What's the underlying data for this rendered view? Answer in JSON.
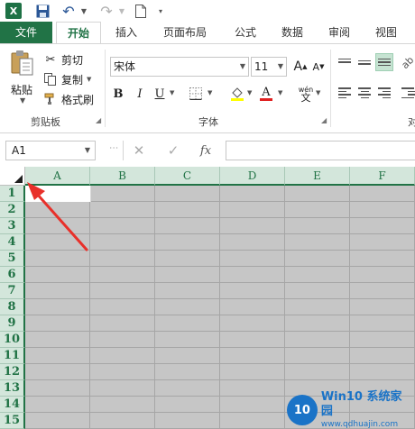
{
  "titlebar": {
    "app_icon_letter": "X"
  },
  "tabs": {
    "file": "文件",
    "home": "开始",
    "insert": "插入",
    "page_layout": "页面布局",
    "formulas": "公式",
    "data": "数据",
    "review": "审阅",
    "view": "视图"
  },
  "ribbon": {
    "paste": "粘贴",
    "cut": "剪切",
    "copy": "复制",
    "format_painter": "格式刷",
    "clipboard_label": "剪贴板",
    "font_name": "宋体",
    "font_size": "11",
    "grow_font": "A",
    "shrink_font": "A",
    "bold": "B",
    "italic": "I",
    "underline": "U",
    "font_color": "A",
    "phonetic": "wén",
    "font_label": "字体",
    "alignment_label_partial": "对"
  },
  "formula_bar": {
    "name_box": "A1",
    "fx": "fx",
    "cancel": "✕",
    "enter": "✓"
  },
  "grid": {
    "columns": [
      "A",
      "B",
      "C",
      "D",
      "E",
      "F"
    ],
    "rows": [
      "1",
      "2",
      "3",
      "4",
      "5",
      "6",
      "7",
      "8",
      "9",
      "10",
      "11",
      "12",
      "13",
      "14",
      "15"
    ]
  },
  "watermark": {
    "logo": "10",
    "title": "Win10 系统家园",
    "url": "www.qdhuajin.com"
  },
  "colors": {
    "excel_green": "#217346",
    "header_bg": "#d3e6db",
    "selection_gray": "#c6c6c6",
    "annotation_red": "#e8302a"
  }
}
